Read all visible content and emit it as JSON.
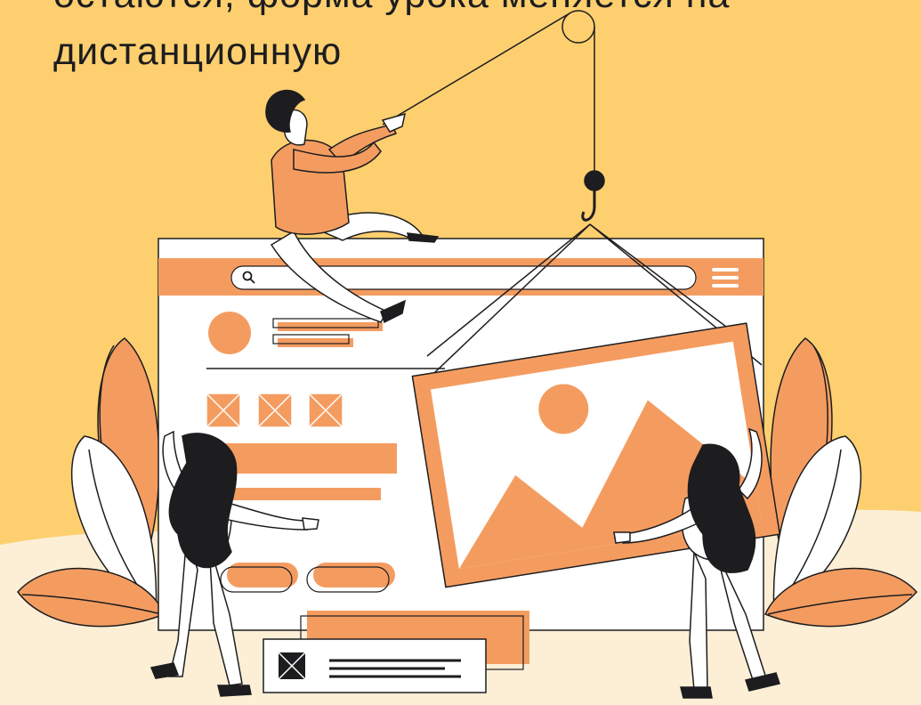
{
  "headline": {
    "line1": "остаются, форма урока меняется на",
    "line2": "дистанционную"
  },
  "colors": {
    "background": "#fdcf6f",
    "ground": "#fcefd6",
    "accent": "#f49c60",
    "ink": "#1d1d1f",
    "white": "#ffffff"
  },
  "icons": [
    "search-icon",
    "hamburger-menu-icon",
    "image-placeholder-icon",
    "crossed-box-icon"
  ]
}
